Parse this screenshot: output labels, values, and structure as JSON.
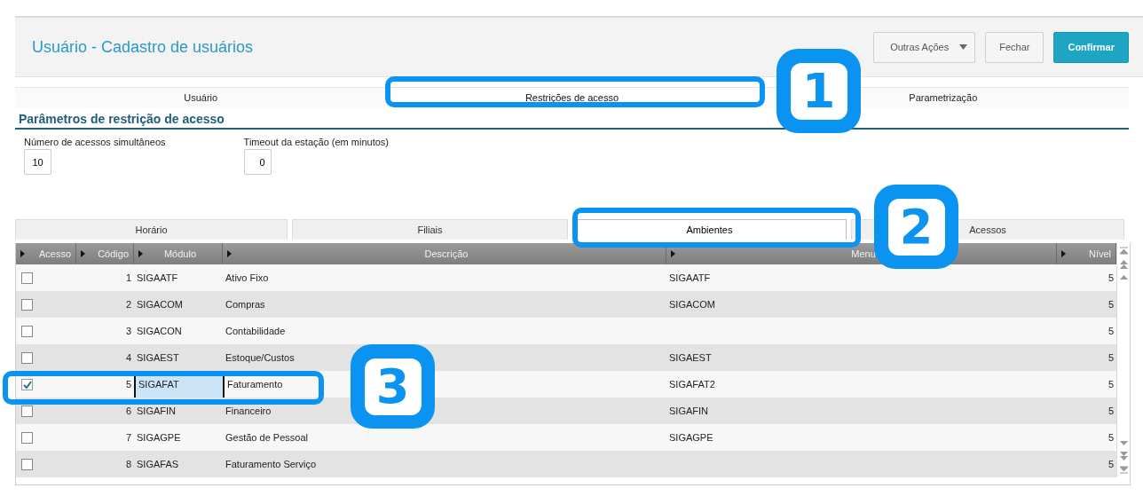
{
  "header": {
    "title": "Usuário - Cadastro de usuários",
    "buttons": [
      {
        "label": "Outras Ações",
        "kind": "menu"
      },
      {
        "label": "Fechar",
        "kind": "default"
      },
      {
        "label": "Confirmar",
        "kind": "primary"
      }
    ]
  },
  "tabs": [
    {
      "label": "Usuário",
      "selected": false
    },
    {
      "label": "Restrições de acesso",
      "selected": true
    },
    {
      "label": "Parametrização",
      "selected": false
    }
  ],
  "section": {
    "title": "Parâmetros de restrição de acesso"
  },
  "fields": [
    {
      "label": "Número de acessos simultâneos",
      "value": "10"
    },
    {
      "label": "Timeout da estação (em minutos)",
      "value": "0"
    }
  ],
  "subtabs": [
    {
      "label": "Horário",
      "selected": false
    },
    {
      "label": "Filiais",
      "selected": false
    },
    {
      "label": "Ambientes",
      "selected": true
    },
    {
      "label": "Acessos",
      "selected": false
    }
  ],
  "grid": {
    "columns": [
      "Acesso",
      "Código",
      "Módulo",
      "Descrição",
      "Menu",
      "Nível"
    ],
    "rows": [
      {
        "checked": false,
        "code": "1",
        "module": "SIGAATF",
        "description": "Ativo Fixo",
        "menu": "SIGAATF",
        "nivel": "5",
        "selected": false
      },
      {
        "checked": false,
        "code": "2",
        "module": "SIGACOM",
        "description": "Compras",
        "menu": "SIGACOM",
        "nivel": "5",
        "selected": false
      },
      {
        "checked": false,
        "code": "3",
        "module": "SIGACON",
        "description": "Contabilidade",
        "nivel": "5",
        "selected": false
      },
      {
        "checked": false,
        "code": "4",
        "module": "SIGAEST",
        "description": "Estoque/Custos",
        "menu": "SIGAEST",
        "nivel": "5",
        "selected": false
      },
      {
        "checked": true,
        "code": "5",
        "module": "SIGAFAT",
        "description": "Faturamento",
        "menu": "SIGAFAT2",
        "nivel": "5",
        "selected": true
      },
      {
        "checked": false,
        "code": "6",
        "module": "SIGAFIN",
        "description": "Financeiro",
        "menu": "SIGAFIN",
        "nivel": "5",
        "selected": false
      },
      {
        "checked": false,
        "code": "7",
        "module": "SIGAGPE",
        "description": "Gestão de Pessoal",
        "menu": "SIGAGPE",
        "nivel": "5",
        "selected": false
      },
      {
        "checked": false,
        "code": "8",
        "module": "SIGAFAS",
        "description": "Faturamento Serviço",
        "nivel": "5",
        "selected": false
      }
    ]
  },
  "callouts": [
    {
      "label": "1"
    },
    {
      "label": "2"
    },
    {
      "label": "3"
    }
  ]
}
